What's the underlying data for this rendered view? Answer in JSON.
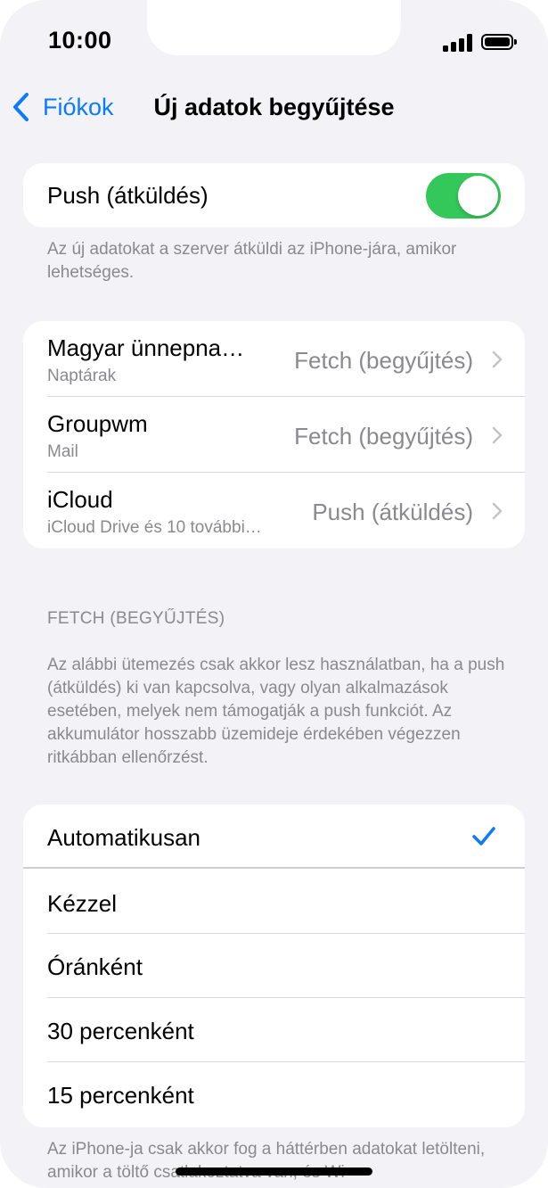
{
  "status_bar": {
    "time": "10:00"
  },
  "nav": {
    "back_label": "Fiókok",
    "title": "Új adatok begyűjtése"
  },
  "push_section": {
    "label": "Push (átküldés)",
    "enabled": true,
    "footer": "Az új adatokat a szerver átküldi az iPhone-jára, amikor lehetséges."
  },
  "accounts": [
    {
      "title": "Magyar ünnepna…",
      "subtitle": "Naptárak",
      "value": "Fetch (begyűjtés)"
    },
    {
      "title": "Groupwm",
      "subtitle": "Mail",
      "value": "Fetch (begyűjtés)"
    },
    {
      "title": "iCloud",
      "subtitle": "iCloud Drive és 10 további…",
      "value": "Push (átküldés)"
    }
  ],
  "fetch_section": {
    "header": "FETCH (BEGYŰJTÉS)",
    "description": "Az alábbi ütemezés csak akkor lesz használatban, ha a push (átküldés) ki van kapcsolva, vagy olyan alkalmazások esetében, melyek nem támogatják a push funkciót. Az akkumulátor hosszabb üzemideje érdekében végezzen ritkábban ellenőrzést.",
    "options": [
      {
        "label": "Automatikusan",
        "selected": true
      },
      {
        "label": "Kézzel",
        "selected": false
      },
      {
        "label": "Óránként",
        "selected": false
      },
      {
        "label": "30 percenként",
        "selected": false
      },
      {
        "label": "15 percenként",
        "selected": false
      }
    ],
    "footer": "Az iPhone-ja csak akkor fog a háttérben adatokat letölteni, amikor a töltő csatlakoztatva van, és Wi-"
  },
  "colors": {
    "accent": "#0a7aff",
    "toggle_on": "#34c759",
    "background": "#f2f2f7"
  }
}
